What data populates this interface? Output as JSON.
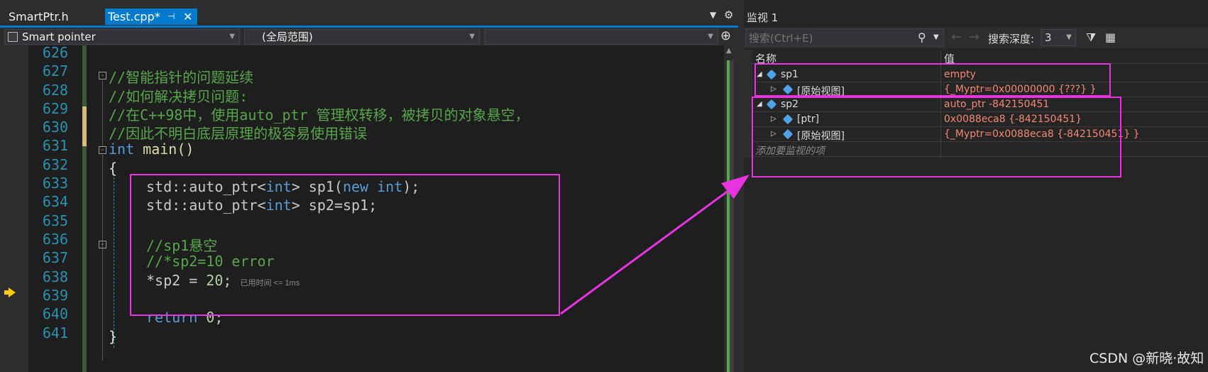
{
  "editor": {
    "tabs": [
      {
        "label": "SmartPtr.h"
      },
      {
        "label": "Test.cpp*",
        "pin": "⊣",
        "close": "✕"
      }
    ],
    "nav": {
      "project": "Smart pointer",
      "scope": "(全局范围)",
      "member": ""
    },
    "lines": [
      {
        "no": "626"
      },
      {
        "no": "627"
      },
      {
        "no": "628"
      },
      {
        "no": "629"
      },
      {
        "no": "630"
      },
      {
        "no": "631"
      },
      {
        "no": "632"
      },
      {
        "no": "633"
      },
      {
        "no": "634"
      },
      {
        "no": "635"
      },
      {
        "no": "636"
      },
      {
        "no": "637"
      },
      {
        "no": "638"
      },
      {
        "no": "639"
      },
      {
        "no": "640"
      },
      {
        "no": "641"
      }
    ],
    "code": {
      "l627": "//智能指针的问题延续",
      "l628": "//如何解决拷贝问题:",
      "l629": "//在C++98中，使用auto_ptr 管理权转移，被拷贝的对象悬空，",
      "l630": "//因此不明白底层原理的极容易使用错误",
      "l631_kw": "int",
      "l631_fn": "main",
      "l631_rest": "()",
      "l632": "{",
      "l633_ns": "std::auto_ptr<",
      "l633_ty": "int",
      "l633_a": "> sp1(",
      "l633_kw": "new",
      "l633_ty2": "int",
      "l633_b": ");",
      "l634_ns": "std::auto_ptr<",
      "l634_ty": "int",
      "l634_a": "> sp2=sp1;",
      "l636": "//sp1悬空",
      "l637": "//*sp2=10 error",
      "l638_a": "*sp2 = ",
      "l638_num": "20",
      "l638_b": ";",
      "l638_hint": "已用时间 <= 1ms",
      "l640_kw": "return",
      "l640_num": "0",
      "l640_b": ";",
      "l641": "}"
    }
  },
  "watch": {
    "title": "监视 1",
    "search_placeholder": "搜索(Ctrl+E)",
    "depth_label": "搜索深度:",
    "depth_value": "3",
    "columns": {
      "name": "名称",
      "value": "值"
    },
    "rows": [
      {
        "name": "sp1",
        "value": "empty"
      },
      {
        "name": "[原始视图]",
        "value": "{_Myptr=0x00000000 {???} }"
      },
      {
        "name": "sp2",
        "value": "auto_ptr -842150451"
      },
      {
        "name": "[ptr]",
        "value": "0x0088eca8 {-842150451}"
      },
      {
        "name": "[原始视图]",
        "value": "{_Myptr=0x0088eca8 {-842150451} }"
      }
    ],
    "add_item": "添加要监视的项"
  },
  "watermark": "CSDN @新晓·故知",
  "colors": {
    "accent": "#007acc",
    "highlight": "#e733e0",
    "watch_value": "#f48771",
    "comment": "#57a64a"
  }
}
